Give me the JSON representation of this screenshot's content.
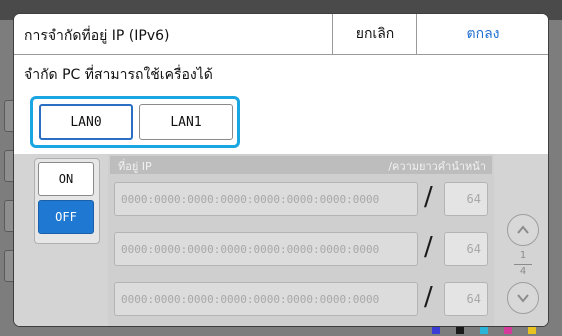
{
  "dialog": {
    "title": "การจำกัดที่อยู่ IP (IPv6)",
    "cancel_label": "ยกเลิก",
    "ok_label": "ตกลง",
    "subtitle": "จำกัด PC ที่สามารถใช้เครื่องได้"
  },
  "lan": {
    "options": [
      "LAN0",
      "LAN1"
    ],
    "selected": "LAN0"
  },
  "toggle": {
    "on_label": "ON",
    "off_label": "OFF",
    "selected": "OFF"
  },
  "address_list": {
    "header_left": "ที่อยู่ IP",
    "header_right": "/ความยาวคำนำหน้า",
    "separator": "/",
    "rows": [
      {
        "address": "0000:0000:0000:0000:0000:0000:0000:0000",
        "prefix": "64"
      },
      {
        "address": "0000:0000:0000:0000:0000:0000:0000:0000",
        "prefix": "64"
      },
      {
        "address": "0000:0000:0000:0000:0000:0000:0000:0000",
        "prefix": "64"
      }
    ]
  },
  "pager": {
    "current": "1",
    "total": "4"
  },
  "colors": {
    "accent": "#1aa6e0",
    "selected_blue": "#1f78d1",
    "ok_text": "#1f6fd1"
  }
}
